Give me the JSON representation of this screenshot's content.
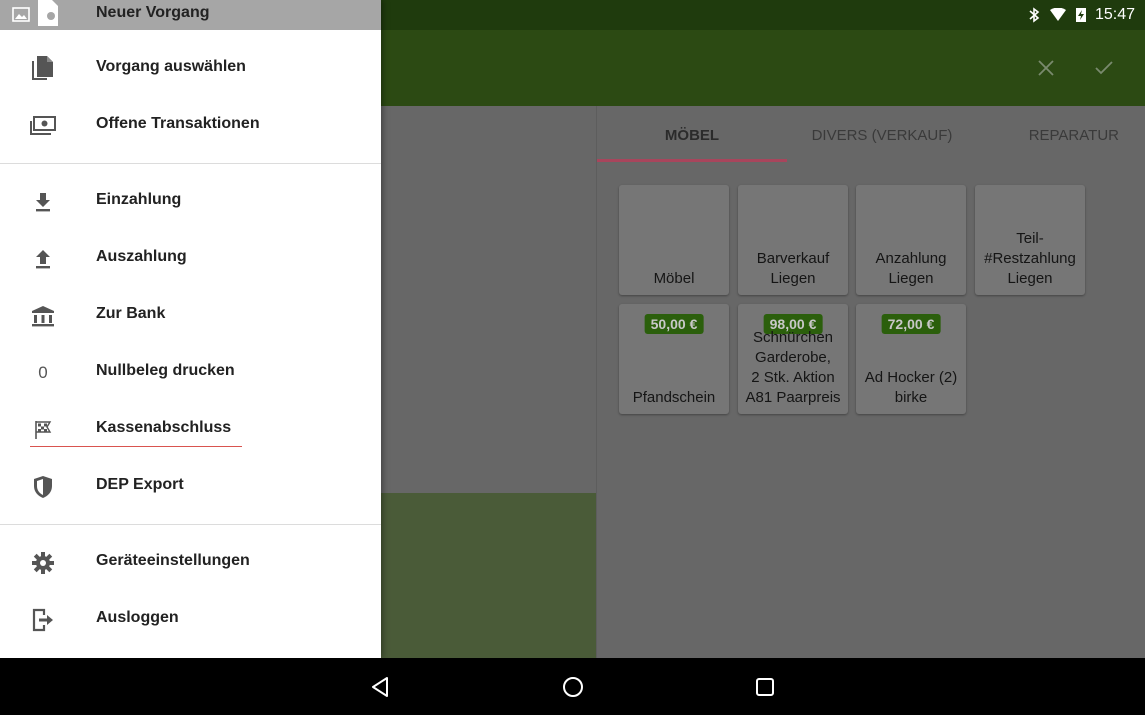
{
  "status_bar": {
    "time": "15:47"
  },
  "tabs": [
    {
      "label": "MÖBEL",
      "active": true
    },
    {
      "label": "DIVERS (VERKAUF)",
      "active": false
    },
    {
      "label": "REPARATUR",
      "active": false
    }
  ],
  "tiles": [
    {
      "label": "Möbel",
      "price": ""
    },
    {
      "label": "Barverkauf\nLiegen",
      "price": ""
    },
    {
      "label": "Anzahlung\nLiegen",
      "price": ""
    },
    {
      "label": "Teil-\n#Restzahlung\nLiegen",
      "price": ""
    },
    {
      "label": "Pfandschein",
      "price": "50,00 €"
    },
    {
      "label": "Schnürchen\nGarderobe,\n2 Stk. Aktion\nA81 Paarpreis",
      "price": "98,00 €"
    },
    {
      "label": "Ad  Hocker (2)\nbirke",
      "price": "72,00 €"
    }
  ],
  "drawer": {
    "header_label": "Neuer Vorgang",
    "items": [
      {
        "label": "Vorgang auswählen",
        "icon": "file-copy-icon"
      },
      {
        "label": "Offene Transaktionen",
        "icon": "cash-icon"
      },
      {
        "label": "Einzahlung",
        "icon": "download-icon"
      },
      {
        "label": "Auszahlung",
        "icon": "upload-icon"
      },
      {
        "label": "Zur Bank",
        "icon": "bank-icon"
      },
      {
        "label": "Nullbeleg drucken",
        "icon": "zero-icon",
        "glyph": "0"
      },
      {
        "label": "Kassenabschluss",
        "icon": "checkered-flag-icon"
      },
      {
        "label": "DEP Export",
        "icon": "shield-icon"
      },
      {
        "label": "Geräteeinstellungen",
        "icon": "gear-icon"
      },
      {
        "label": "Ausloggen",
        "icon": "logout-icon"
      }
    ]
  },
  "colors": {
    "status_bar": "#1f3b0d",
    "app_bar": "#2c4a13",
    "price_badge": "#2b5f0c",
    "tab_indicator": "#a8455c",
    "highlight_underline": "#d9534f"
  }
}
